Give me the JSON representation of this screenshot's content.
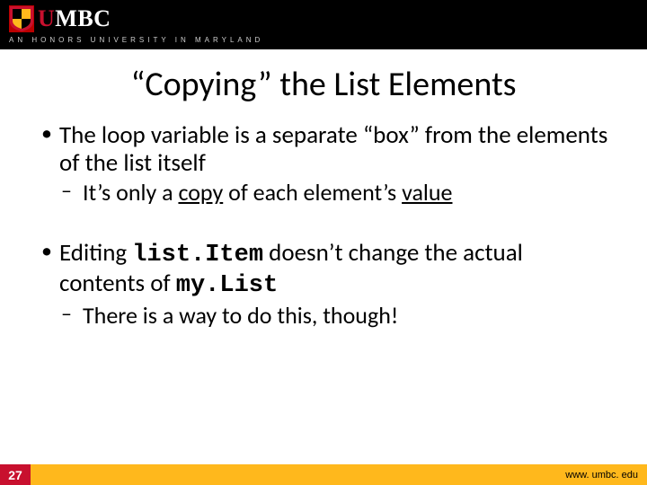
{
  "header": {
    "brand_prefix": "U",
    "brand_rest": "MBC",
    "tagline": "AN HONORS UNIVERSITY IN MARYLAND"
  },
  "title": "“Copying” the List Elements",
  "bullets": [
    {
      "text_a": "The loop variable is a separate “box” from the elements of the list itself",
      "sub": [
        {
          "prefix": "It’s only a ",
          "u1": "copy",
          "mid": " of each element’s ",
          "u2": "value"
        }
      ]
    },
    {
      "prefix": "Editing ",
      "code1": "list.Item",
      "mid": " doesn’t change the actual contents of ",
      "code2": "my.List",
      "sub": [
        {
          "text": "There is a way to do this, though!"
        }
      ]
    }
  ],
  "footer": {
    "slide_number": "27",
    "url": "www. umbc. edu"
  }
}
